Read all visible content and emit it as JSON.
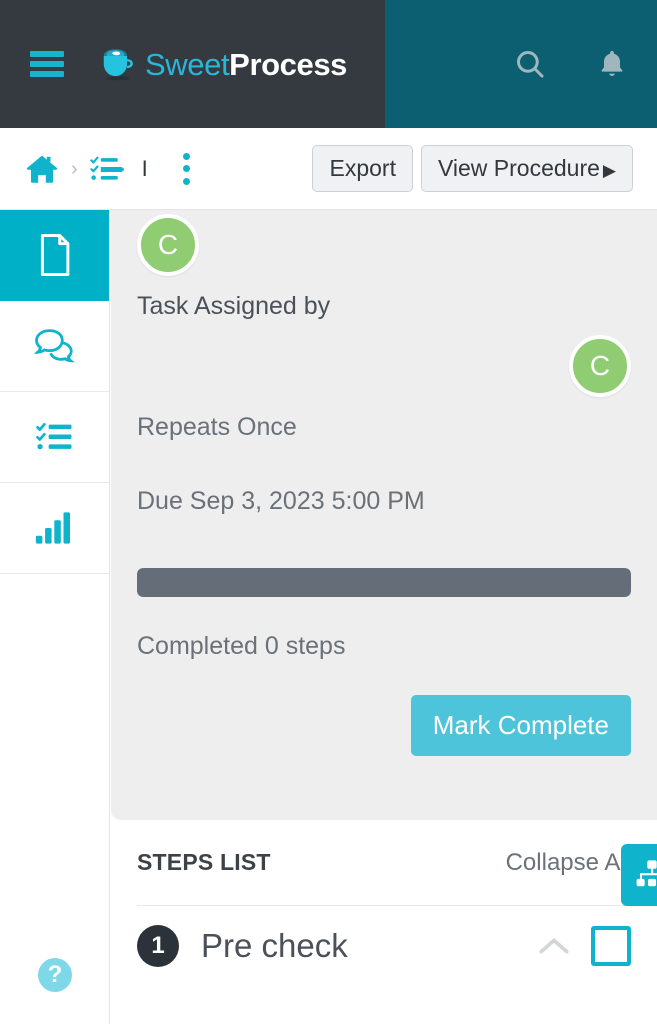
{
  "header": {
    "brand_sweet": "Sweet",
    "brand_process": "Process",
    "menu_icon": "hamburger-icon",
    "logo_icon": "coffee-cup-logo",
    "search_icon": "search-icon",
    "notifications_icon": "bell-icon",
    "dark_bg": "#343a40",
    "teal_bg": "#0b5f70",
    "accent": "#17b4cd"
  },
  "toolbar": {
    "home_icon": "home-icon",
    "separator": "›",
    "procedure_icon": "procedure-checklist-icon",
    "breadcrumb_title": "I",
    "kebab_icon": "more-vertical-icon",
    "export_label": "Export",
    "view_procedure_label": "View Procedure",
    "view_procedure_caret": "▶"
  },
  "sidebar": {
    "items": [
      {
        "name": "document",
        "icon": "document-icon",
        "active": true
      },
      {
        "name": "comments",
        "icon": "comments-icon",
        "active": false
      },
      {
        "name": "tasks",
        "icon": "checklist-icon",
        "active": false
      },
      {
        "name": "reports",
        "icon": "bar-chart-icon",
        "active": false
      }
    ],
    "help_label": "?",
    "help_icon": "help-question-icon"
  },
  "task": {
    "assigner_avatar_initial": "C",
    "assignee_avatar_initial": "C",
    "avatar_color": "#8fcc72",
    "assigned_by_label": "Task Assigned by",
    "repeats_label": "Repeats Once",
    "due_label": "Due Sep 3, 2023 5:00 PM",
    "progress_percent": 100,
    "progress_color": "#656e78",
    "completed_label": "Completed 0 steps",
    "mark_complete_label": "Mark Complete",
    "mark_complete_color": "#4ec4da"
  },
  "steps": {
    "title": "STEPS LIST",
    "collapse_all_label": "Collapse All",
    "fab_icon": "sitemap-icon",
    "fab_color": "#0fb3cc",
    "items": [
      {
        "number": "1",
        "name": "Pre check",
        "chevron": "chevron-up-icon",
        "checked": false
      }
    ]
  }
}
